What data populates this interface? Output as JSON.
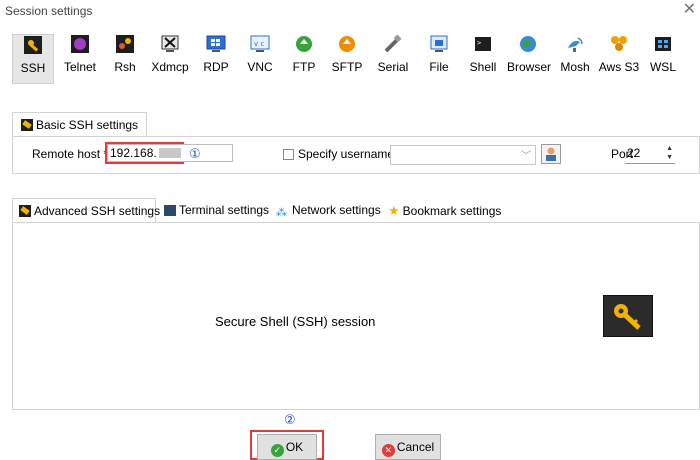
{
  "window": {
    "title": "Session settings",
    "close_glyph": "✕"
  },
  "session_types": [
    {
      "label": "SSH",
      "icon": "ssh-key-icon"
    },
    {
      "label": "Telnet",
      "icon": "telnet-icon"
    },
    {
      "label": "Rsh",
      "icon": "rsh-icon"
    },
    {
      "label": "Xdmcp",
      "icon": "xdmcp-icon"
    },
    {
      "label": "RDP",
      "icon": "rdp-icon"
    },
    {
      "label": "VNC",
      "icon": "vnc-icon"
    },
    {
      "label": "FTP",
      "icon": "ftp-icon"
    },
    {
      "label": "SFTP",
      "icon": "sftp-icon"
    },
    {
      "label": "Serial",
      "icon": "serial-icon"
    },
    {
      "label": "File",
      "icon": "file-icon"
    },
    {
      "label": "Shell",
      "icon": "shell-icon"
    },
    {
      "label": "Browser",
      "icon": "browser-icon"
    },
    {
      "label": "Mosh",
      "icon": "mosh-icon"
    },
    {
      "label": "Aws S3",
      "icon": "aws-s3-icon"
    },
    {
      "label": "WSL",
      "icon": "wsl-icon"
    }
  ],
  "basic": {
    "tab_label": "Basic SSH settings",
    "remote_host_label": "Remote host *",
    "remote_host_value": "192.168.",
    "annotation_1": "①",
    "specify_username_label": "Specify username",
    "port_label": "Port",
    "port_value": "22"
  },
  "advanced_tabs": [
    {
      "label": "Advanced SSH settings",
      "icon": "key-icon"
    },
    {
      "label": "Terminal settings",
      "icon": "terminal-icon"
    },
    {
      "label": "Network settings",
      "icon": "network-icon"
    },
    {
      "label": "Bookmark settings",
      "icon": "star-icon"
    }
  ],
  "content": {
    "description": "Secure Shell (SSH) session"
  },
  "buttons": {
    "annotation_2": "②",
    "ok_label": "OK",
    "cancel_label": "Cancel"
  },
  "colors": {
    "highlight": "#e33a3a",
    "annotation": "#1f4fd6",
    "key_yellow": "#f0b400",
    "ok_green": "#3aa23a",
    "cancel_red": "#e03c3c"
  }
}
